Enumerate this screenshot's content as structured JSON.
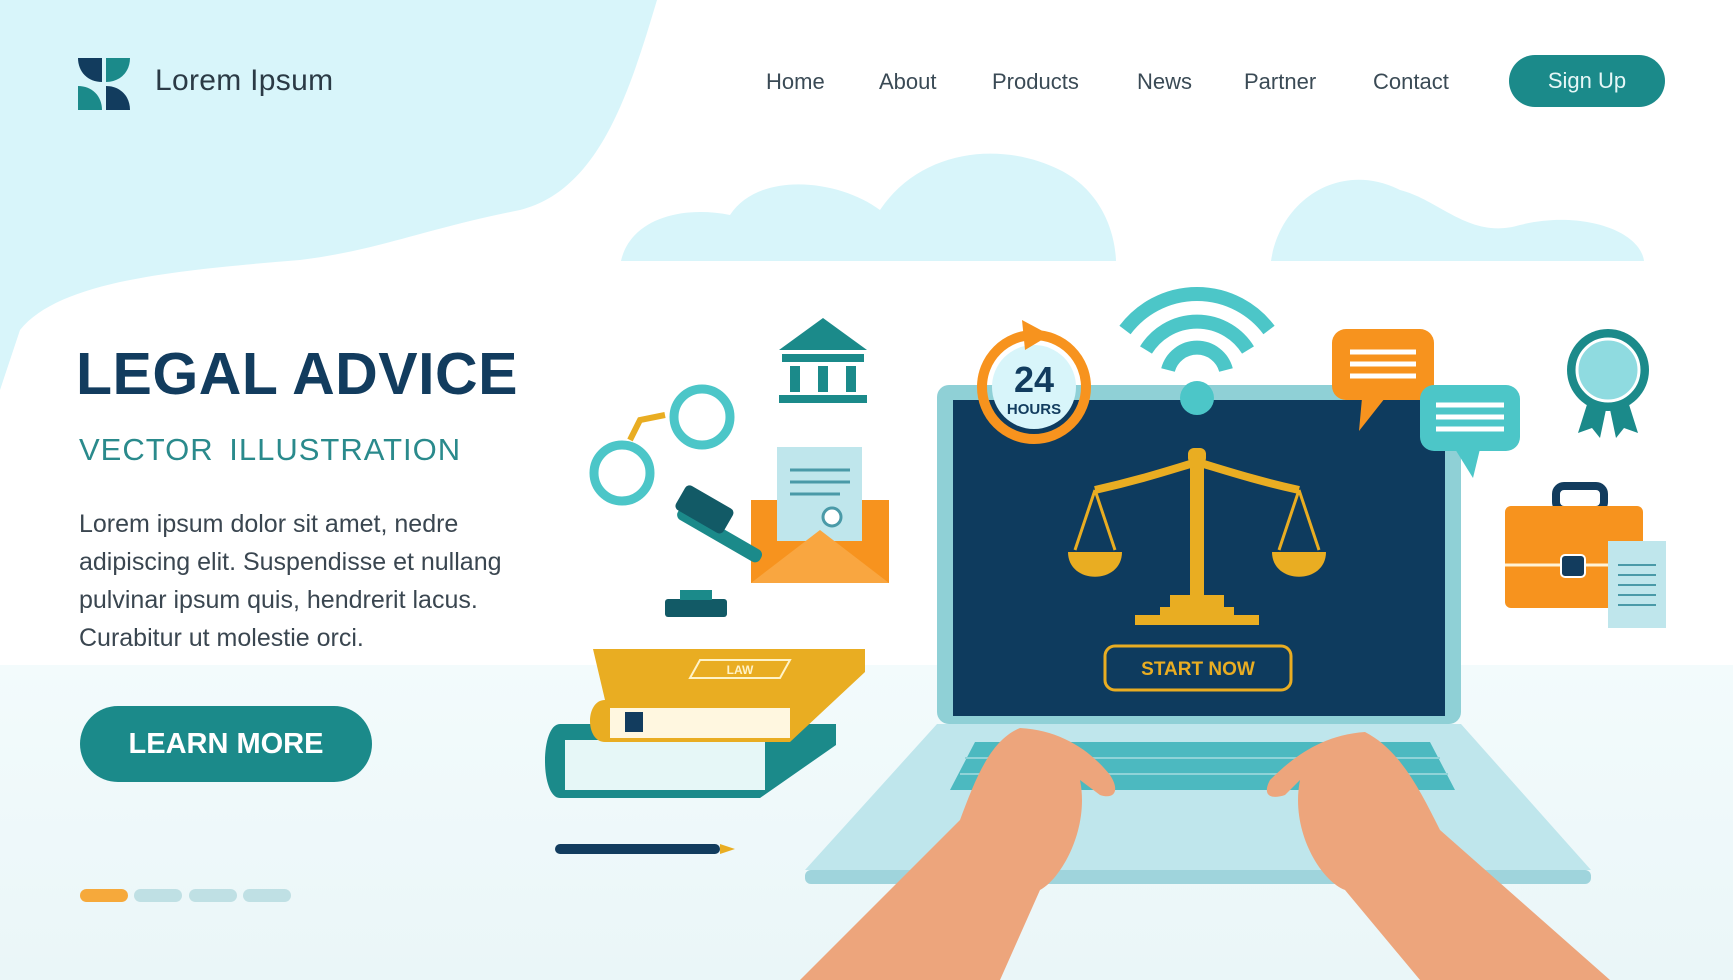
{
  "brand": {
    "name": "Lorem Ipsum",
    "icon": "four-leaf-logo-icon"
  },
  "nav": {
    "items": [
      {
        "label": "Home"
      },
      {
        "label": "About"
      },
      {
        "label": "Products"
      },
      {
        "label": "News"
      },
      {
        "label": "Partner"
      },
      {
        "label": "Contact"
      }
    ],
    "signup_label": "Sign Up"
  },
  "hero": {
    "title": "LEGAL ADVICE",
    "subtitle": "VECTOR  ILLUSTRATION",
    "paragraph": "Lorem ipsum dolor sit amet, nedre adipiscing elit. Suspendisse et nullang pulvinar ipsum quis, hendrerit lacus. Curabitur ut molestie orci.",
    "cta_label": "LEARN MORE"
  },
  "carousel": {
    "slides": 4,
    "active_index": 0
  },
  "illustration": {
    "clock_number": "24",
    "clock_label": "HOURS",
    "screen_button": "START NOW",
    "book_label": "LAW"
  },
  "colors": {
    "navy": "#123c5e",
    "teal": "#1b8a8a",
    "light_teal": "#4cc6c8",
    "orange": "#f7931e",
    "gold": "#e9ad22",
    "sky": "#d8f5fa"
  }
}
